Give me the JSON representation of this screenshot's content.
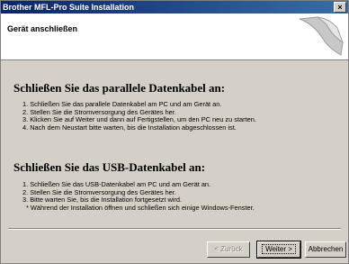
{
  "window": {
    "title": "Brother MFL-Pro Suite Installation",
    "close_glyph": "×"
  },
  "header": {
    "title": "Gerät anschließen"
  },
  "sections": [
    {
      "title": "Schließen Sie das parallele Datenkabel an:",
      "items": [
        "1. Schließen Sie das parallele Datenkabel am PC und am Gerät an.",
        "2. Stellen Sie die Stromversorgung des Gerätes her.",
        "3. Klicken Sie auf Weiter und dann auf Fertigstellen, um den PC neu zu starten.",
        "4. Nach dem Neustart bitte warten, bis die Installation abgeschlossen ist."
      ]
    },
    {
      "title": "Schließen Sie das USB-Datenkabel an:",
      "items": [
        "1. Schließen Sie das USB-Datenkabel am PC und am Gerät an.",
        "2. Stellen Sie die Stromversorgung des Gerätes her.",
        "3. Bitte warten Sie, bis die Installation fortgesetzt wird.",
        "* Während der Installation öffnen und schließen sich einige Windows-Fenster."
      ]
    }
  ],
  "buttons": {
    "back": "< Zurück",
    "next": "Weiter >",
    "cancel": "Abbrechen"
  }
}
